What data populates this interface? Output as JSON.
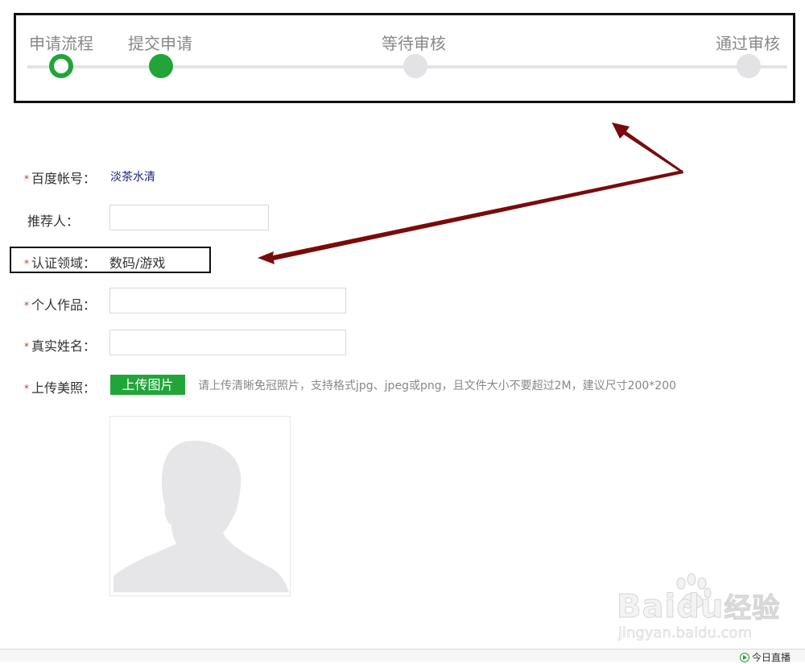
{
  "steps": [
    {
      "label": "申请流程",
      "state": "current"
    },
    {
      "label": "提交申请",
      "state": "done"
    },
    {
      "label": "等待审核",
      "state": "pending"
    },
    {
      "label": "通过审核",
      "state": "pending"
    }
  ],
  "form": {
    "baidu_account": {
      "label": "百度帐号：",
      "value": "淡茶水清",
      "required": true
    },
    "referrer": {
      "label": "推荐人：",
      "value": "",
      "required": false
    },
    "cert_field": {
      "label": "认证领域：",
      "value": "数码/游戏",
      "required": true
    },
    "works": {
      "label": "个人作品：",
      "value": "",
      "required": true
    },
    "real_name": {
      "label": "真实姓名：",
      "value": "",
      "required": true
    },
    "photo": {
      "label": "上传美照：",
      "required": true,
      "button": "上传图片",
      "hint": "请上传清晰免冠照片，支持格式jpg、jpeg或png，且文件大小不要超过2M，建议尺寸200*200"
    }
  },
  "required_mark": "*",
  "watermark": {
    "brand": "Baidu",
    "product": "经验",
    "url": "jingyan.baidu.com"
  },
  "bottom_bar": {
    "live_label": "今日直播"
  },
  "colors": {
    "accent": "#21a539",
    "pending": "#e3e3e6",
    "annotation_arrow": "#7a0b0b",
    "link": "#1a237e"
  }
}
